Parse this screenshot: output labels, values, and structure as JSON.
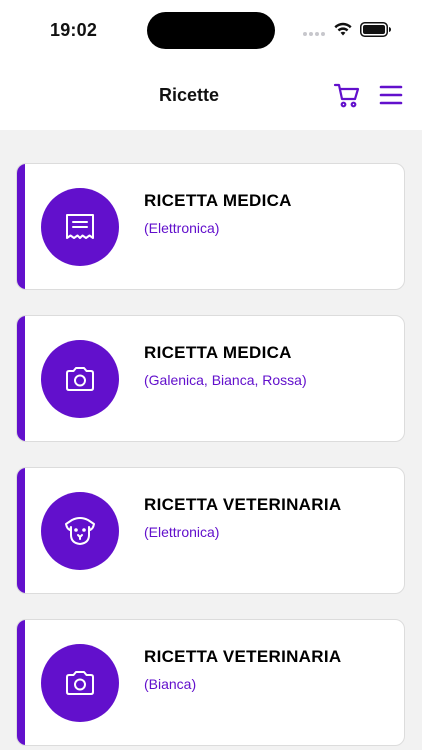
{
  "status_bar": {
    "time": "19:02"
  },
  "header": {
    "title": "Ricette",
    "cart_icon": "cart-icon",
    "menu_icon": "menu-icon"
  },
  "accent_color": "#6210cc",
  "cards": [
    {
      "title": "RICETTA MEDICA",
      "subtitle": "(Elettronica)",
      "icon": "receipt-icon"
    },
    {
      "title": "RICETTA MEDICA",
      "subtitle": "(Galenica, Bianca, Rossa)",
      "icon": "camera-icon"
    },
    {
      "title": "RICETTA VETERINARIA",
      "subtitle": "(Elettronica)",
      "icon": "dog-icon"
    },
    {
      "title": "RICETTA VETERINARIA",
      "subtitle": "(Bianca)",
      "icon": "camera-icon"
    }
  ]
}
